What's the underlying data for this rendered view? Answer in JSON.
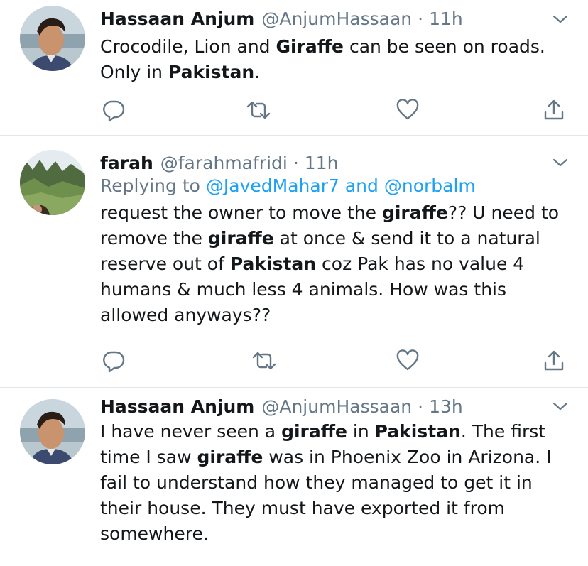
{
  "tweets": [
    {
      "name": "Hassaan Anjum",
      "handle": "@AnjumHassaan",
      "separator": "·",
      "time": "11h",
      "text_segments": [
        {
          "t": "Crocodile, Lion and ",
          "b": false
        },
        {
          "t": "Giraffe",
          "b": true
        },
        {
          "t": " can be seen on roads. Only in ",
          "b": false
        },
        {
          "t": "Pakistan",
          "b": true
        },
        {
          "t": ".",
          "b": false
        }
      ]
    },
    {
      "name": "farah",
      "handle": "@farahmafridi",
      "separator": "·",
      "time": "11h",
      "replying_to": {
        "prefix": "Replying to",
        "mention_1": "@JavedMahar7",
        "joiner": "and",
        "mention_2": "@norbalm"
      },
      "text_segments": [
        {
          "t": "request the owner to move the ",
          "b": false
        },
        {
          "t": "giraffe",
          "b": true
        },
        {
          "t": "?? U need to remove the ",
          "b": false
        },
        {
          "t": "giraffe",
          "b": true
        },
        {
          "t": " at once & send it to a natural reserve out of ",
          "b": false
        },
        {
          "t": "Pakistan",
          "b": true
        },
        {
          "t": " coz Pak has no value 4 humans & much less 4 animals. How was this allowed anyways??",
          "b": false
        }
      ]
    },
    {
      "name": "Hassaan Anjum",
      "handle": "@AnjumHassaan",
      "separator": "·",
      "time": "13h",
      "text_segments": [
        {
          "t": "I have never seen a ",
          "b": false
        },
        {
          "t": "giraffe",
          "b": true
        },
        {
          "t": " in ",
          "b": false
        },
        {
          "t": "Pakistan",
          "b": true
        },
        {
          "t": ". The first time I saw  ",
          "b": false
        },
        {
          "t": "giraffe",
          "b": true
        },
        {
          "t": " was in Phoenix Zoo in Arizona. I fail to understand how they managed to get it in their house. They must have exported it from somewhere.",
          "b": false
        }
      ]
    }
  ],
  "icons": {
    "reply": "reply-icon",
    "retweet": "retweet-icon",
    "like": "like-icon",
    "share": "share-icon",
    "caret": "chevron-down-icon"
  },
  "colors": {
    "text": "#14171a",
    "secondary": "#657786",
    "link": "#1da1f2",
    "divider": "#e1e8ed"
  }
}
